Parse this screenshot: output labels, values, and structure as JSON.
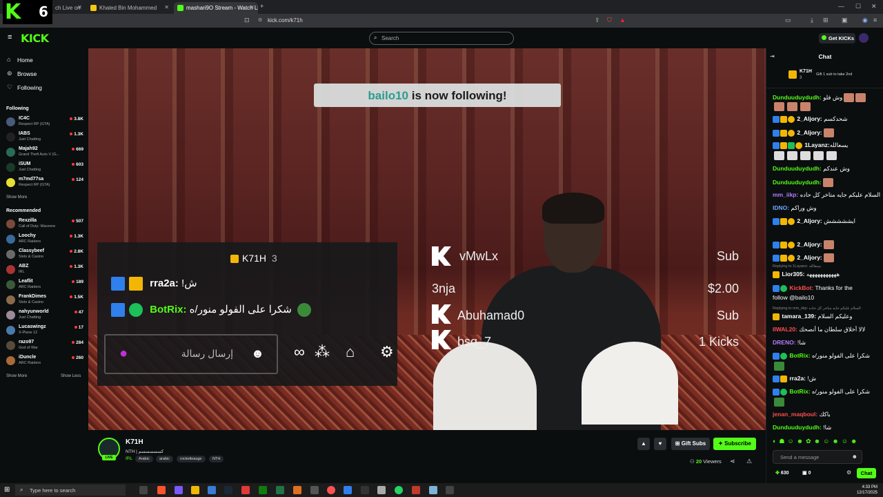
{
  "browser": {
    "tabs": [
      {
        "label": "ch Live on"
      },
      {
        "label": "Khaled Bin Mohammed"
      },
      {
        "label": "mashari9O Stream - Watch Live on K"
      }
    ],
    "url": "kick.com/k71h"
  },
  "overlay_badge": {
    "logo": "K",
    "number": "6"
  },
  "header": {
    "logo": "KICK",
    "search_placeholder": "Search",
    "get_kicks": "Get KICKs"
  },
  "sidebar": {
    "nav": [
      {
        "label": "Home",
        "icon": "home-icon"
      },
      {
        "label": "Browse",
        "icon": "compass-icon"
      },
      {
        "label": "Following",
        "icon": "heart-icon"
      }
    ],
    "following_title": "Following",
    "following": [
      {
        "name": "IC4C",
        "category": "Respect RP (GTA)",
        "viewers": "3.8K"
      },
      {
        "name": "IABS",
        "category": "Just Chatting",
        "viewers": "1.3K"
      },
      {
        "name": "Majah92",
        "category": "Grand Theft Auto V (G...",
        "viewers": "669"
      },
      {
        "name": "iSUM",
        "category": "Just Chatting",
        "viewers": "603"
      },
      {
        "name": "m7md77sa",
        "category": "Respect RP (GTA)",
        "viewers": "124"
      }
    ],
    "show_more_1": "Show More",
    "recommended_title": "Recommended",
    "recommended": [
      {
        "name": "Rexzilla",
        "category": "Call of Duty: Warzone",
        "viewers": "507"
      },
      {
        "name": "Loochy",
        "category": "ARC Raiders",
        "viewers": "1.3K"
      },
      {
        "name": "Classybeef",
        "category": "Slots & Casino",
        "viewers": "2.8K"
      },
      {
        "name": "ABZ",
        "category": "IRL",
        "viewers": "1.3K"
      },
      {
        "name": "Leaflit",
        "category": "ARC Raiders",
        "viewers": "189"
      },
      {
        "name": "FrankDimes",
        "category": "Slots & Casino",
        "viewers": "1.5K"
      },
      {
        "name": "nahyunworld",
        "category": "Just Chatting",
        "viewers": "47"
      },
      {
        "name": "Lucaswingz",
        "category": "X-Plane 12",
        "viewers": "17"
      },
      {
        "name": "razo97",
        "category": "God of War",
        "viewers": "284"
      },
      {
        "name": "iDuncle",
        "category": "ARC Raiders",
        "viewers": "260"
      }
    ],
    "show_more_2": "Show More",
    "show_less": "Show Less"
  },
  "video": {
    "follow_alert_user": "bailo10",
    "follow_alert_text": " is now following!",
    "chat_overlay": {
      "header": "K71H",
      "header_count": "3",
      "lines": [
        {
          "user": "rra2a:",
          "text": "!ش"
        },
        {
          "user": "BotRix:",
          "text": "شكرا على الفولو منور/ه"
        }
      ],
      "input_placeholder": "إرسال رسالة"
    },
    "events": [
      {
        "name": "vMwLx",
        "amount": "Sub"
      },
      {
        "name": "3nja",
        "amount": "$2.00"
      },
      {
        "name": "Abuhamad0",
        "amount": "Sub"
      },
      {
        "name": "bsq_7",
        "amount": "1 Kicks"
      }
    ]
  },
  "stream": {
    "name": "K71H",
    "title": "NTH | كسسسسسم",
    "category": "IRL",
    "tags": [
      "Arabic",
      "arabic",
      "rocketleauge",
      "NTH"
    ],
    "gift_subs": "Gift Subs",
    "subscribe": "Subscribe",
    "viewers": "20",
    "viewers_label": "Viewers",
    "live": "LIVE"
  },
  "chat": {
    "title": "Chat",
    "pinned_user": "K71H",
    "pinned_count": "3",
    "pinned_text": "Gift 1 sub to take 2nd",
    "messages": [
      {
        "user": "Dunduuduydudh:",
        "text": "وش فلو",
        "color": "#53fc18"
      },
      {
        "user": "2_Aljory:",
        "text": "شحدكسم",
        "color": "#ffffff"
      },
      {
        "user": "2_Aljory:",
        "text": "",
        "color": "#ffffff"
      },
      {
        "user": "1Layanz:",
        "text": "يسعالله",
        "color": "#ffffff"
      },
      {
        "user": "Dunduuduydudh:",
        "text": "وش عندكم",
        "color": "#53fc18"
      },
      {
        "user": "Dunduuduydudh:",
        "text": "",
        "color": "#53fc18"
      },
      {
        "user": "mm_iikp:",
        "text": "السلام عليكم جايه متاخر كل حاده",
        "color": "#b57bff"
      },
      {
        "user": "IDNO:",
        "text": "وش وراكم",
        "color": "#6ea8ff"
      },
      {
        "user": "2_Aljory:",
        "text": "ايششششش",
        "color": "#ffffff"
      },
      {
        "user": "2_Aljory:",
        "text": "",
        "color": "#ffffff"
      },
      {
        "user": "2_Aljory:",
        "text": "",
        "color": "#ffffff"
      },
      {
        "user": "Lior305:",
        "text": "هههههههههههه",
        "color": "#ffffff"
      },
      {
        "user": "KickBot:",
        "text": "Thanks for the",
        "color": "#ff4d4d"
      },
      {
        "user": "",
        "text": "follow @bailo10",
        "color": "#ffffff"
      },
      {
        "user": "tamara_139:",
        "text": "وعليكم السلام",
        "color": "#ffffff"
      },
      {
        "user": "IIWAL20:",
        "text": "لالا أخلاق سلطان ما أنصحك",
        "color": "#ff4d4d"
      },
      {
        "user": "DRENO:",
        "text": "!شا",
        "color": "#b57bff"
      },
      {
        "user": "BotRix:",
        "text": "شكرا على الفولو منور/ه",
        "color": "#53fc18"
      },
      {
        "user": "rra2a:",
        "text": "!ش",
        "color": "#ffffff"
      },
      {
        "user": "BotRix:",
        "text": "شكرا على الفولو منور/ه",
        "color": "#53fc18"
      },
      {
        "user": "jenan_maqboul:",
        "text": "باكك",
        "color": "#ff4d4d"
      },
      {
        "user": "Dunduuduydudh:",
        "text": "!شا",
        "color": "#53fc18"
      }
    ],
    "reply_1": "Replying to 1Layanz: يسعالله",
    "reply_2": "Replying to mm_iikp: السلام عليكم جايه متاخر كل حاده",
    "input_placeholder": "Send a message",
    "kicks_count": "630",
    "gifts_count": "0",
    "chat_button": "Chat"
  },
  "taskbar": {
    "search_placeholder": "Type here to search",
    "time": "4:33 PM",
    "date": "12/17/2025"
  },
  "colors": {
    "accent": "#53fc18",
    "background": "#0b0e0f"
  }
}
